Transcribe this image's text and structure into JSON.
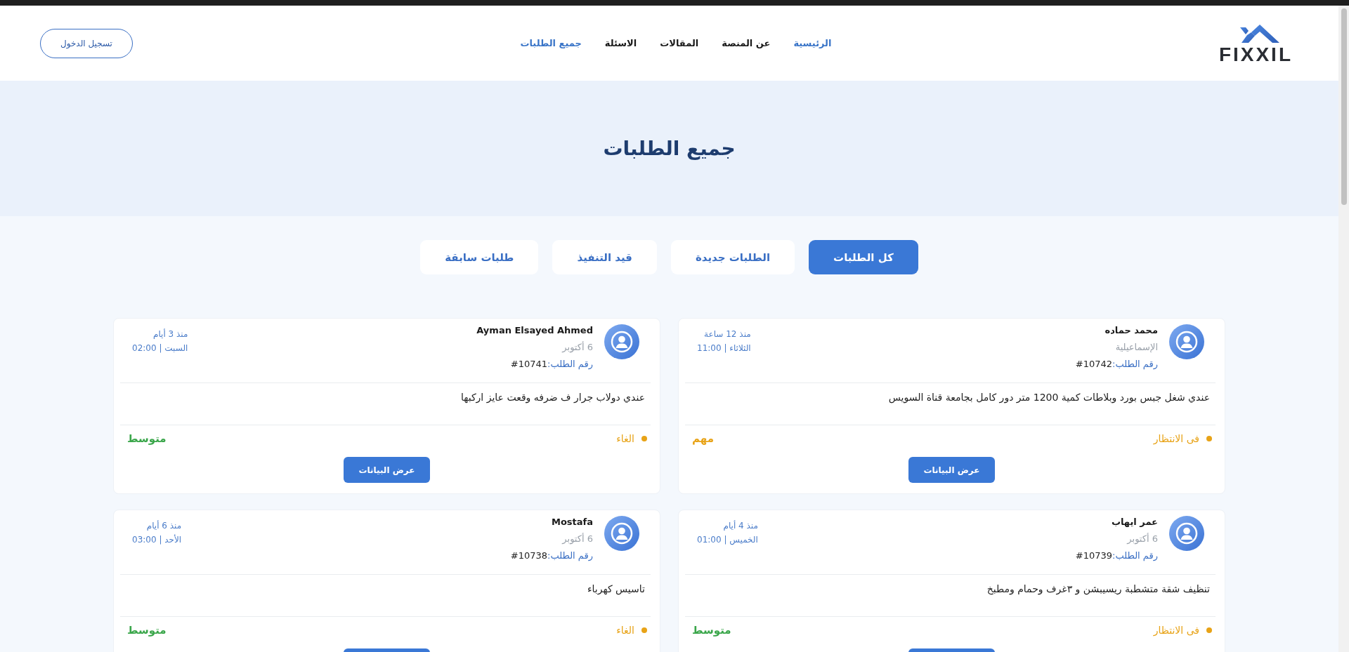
{
  "header": {
    "logo": {
      "text": "FIXXIL"
    },
    "nav": [
      {
        "label": "الرئيسية",
        "selected": true
      },
      {
        "label": "عن المنصة",
        "selected": false
      },
      {
        "label": "المقالات",
        "selected": false
      },
      {
        "label": "الاسئلة",
        "selected": false
      },
      {
        "label": "جميع الطلبات",
        "selected": true
      }
    ],
    "login_button": "تسجيل الدخول"
  },
  "hero": {
    "title": "جميع الطلبات"
  },
  "tabs": [
    {
      "label": "كل الطلبات",
      "selected": true
    },
    {
      "label": "الطلبات جديدة",
      "selected": false
    },
    {
      "label": "قيد التنفيذ",
      "selected": false
    },
    {
      "label": "طلبات سابقة",
      "selected": false
    }
  ],
  "cards": [
    {
      "name": "محمد حماده",
      "subtitle": "الإسماعيلية",
      "order_label": "رقم الطلب:",
      "order_number": "#10742",
      "time_ago": "منذ 12 ساعة",
      "day_time": "الثلاثاء | 11:00",
      "description": "عندي شغل جبس بورد وبلاطات كمية 1200 متر دور كامل بجامعة قناة السويس",
      "status": {
        "label": "فى الانتظار",
        "color": "#e8a317"
      },
      "priority": {
        "label": "مهم",
        "color": "#e8a317"
      },
      "button": true,
      "button_label": "عرض البيانات"
    },
    {
      "name": "Ayman Elsayed Ahmed",
      "subtitle": "6 أكتوبر",
      "order_label": "رقم الطلب:",
      "order_number": "#10741",
      "time_ago": "منذ 3 أيام",
      "day_time": "السبت | 02:00",
      "description": "عندي دولاب جرار ف ضرفه وقعت عايز اركبها",
      "status": {
        "label": "الغاء",
        "color": "#e8a317"
      },
      "priority": {
        "label": "متوسط",
        "color": "#3aa64a"
      },
      "button": true,
      "button_label": "عرض البيانات"
    },
    {
      "name": "عمر ايهاب",
      "subtitle": "6 أكتوبر",
      "order_label": "رقم الطلب:",
      "order_number": "#10739",
      "time_ago": "منذ 4 أيام",
      "day_time": "الخميس | 01:00",
      "description": "تنظيف شقة متشطبة ريسيبشن و ٣غرف وحمام ومطبخ",
      "status": {
        "label": "فى الانتظار",
        "color": "#e8a317"
      },
      "priority": {
        "label": "متوسط",
        "color": "#3aa64a"
      },
      "button": true
    },
    {
      "name": "Mostafa",
      "subtitle": "6 أكتوبر",
      "order_label": "رقم الطلب:",
      "order_number": "#10738",
      "time_ago": "منذ 6 أيام",
      "day_time": "الأحد | 03:00",
      "description": "تاسيس كهرباء",
      "status": {
        "label": "الغاء",
        "color": "#e8a317"
      },
      "priority": {
        "label": "متوسط",
        "color": "#3aa64a"
      },
      "button": true
    }
  ]
}
